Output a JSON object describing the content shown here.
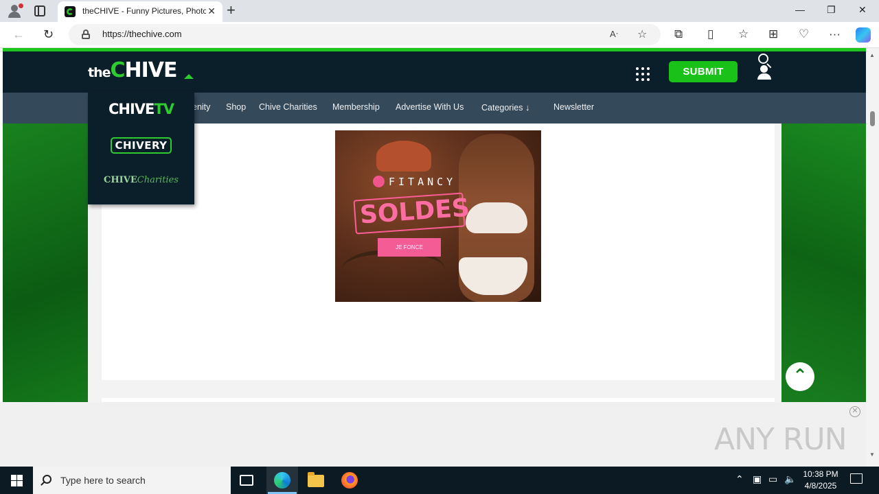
{
  "browser": {
    "tab_title": "theCHIVE - Funny Pictures, Photo",
    "tab_close": "✕",
    "new_tab": "+",
    "url": "https://thechive.com",
    "window_controls": {
      "minimize": "—",
      "restore": "❐",
      "close": "✕"
    },
    "icons": [
      "back-icon",
      "refresh-icon",
      "read-aloud-icon",
      "favorite-star-icon",
      "extensions-icon",
      "split-screen-icon",
      "favorites-icon",
      "collections-icon",
      "browser-essentials-icon",
      "more-icon",
      "copilot-icon"
    ]
  },
  "site": {
    "logo_the": "the",
    "logo_c": "C",
    "logo_rest": "HIVE",
    "submit_label": "SUBMIT",
    "nav": {
      "items": [
        "enity",
        "Shop",
        "Chive Charities",
        "Membership",
        "Advertise With Us",
        "Categories",
        "Newsletter"
      ],
      "categories_arrow": "↓"
    },
    "dropdown": {
      "chivetv": "CHIVE",
      "chivetv_suffix": "TV",
      "chivery": "CHIVERY",
      "charities_main": "CHIVE",
      "charities_script": "Charities"
    },
    "ad": {
      "brand": "FITANCY",
      "headline": "SOLDES",
      "cta": "JE FONCE"
    },
    "scroll_top_glyph": "⌃"
  },
  "overlay": {
    "close_glyph": "✕",
    "watermark": "ANY RUN"
  },
  "taskbar": {
    "search_placeholder": "Type here to search",
    "time": "10:38 PM",
    "date": "4/8/2025"
  },
  "colors": {
    "site_green": "#1ec41e",
    "header_dark": "#0b1f2a",
    "nav_bar": "#34495a",
    "submit_green": "#19c119",
    "ad_pink": "#f45c95"
  }
}
